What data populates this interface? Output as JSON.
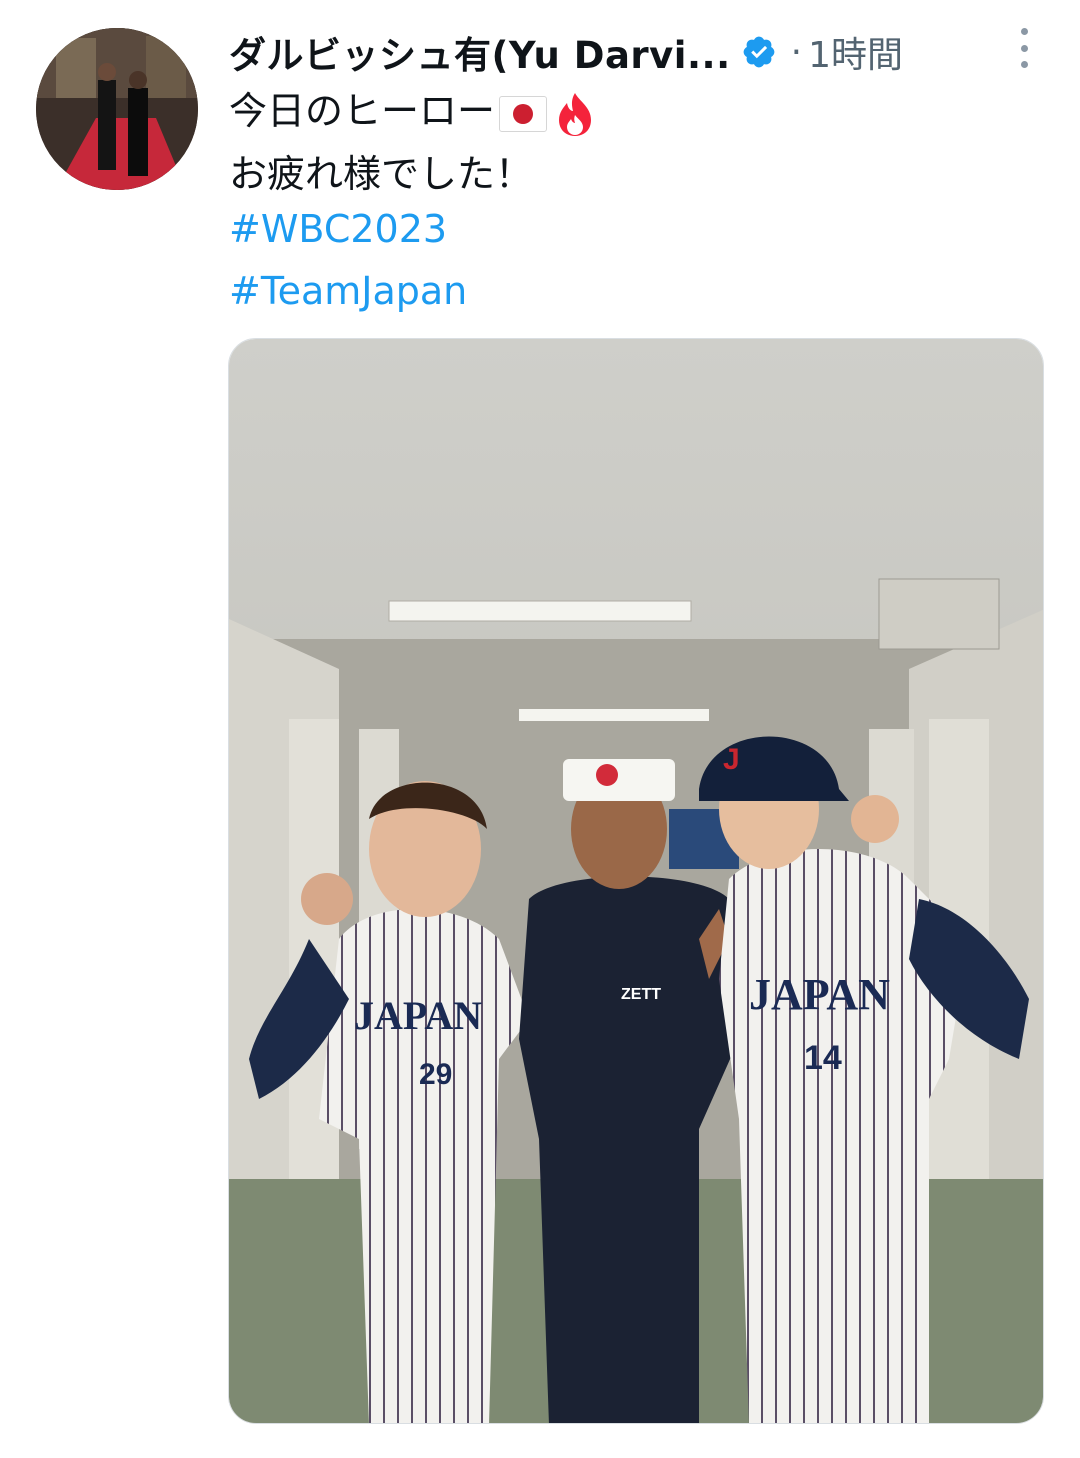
{
  "tweet": {
    "display_name": "ダルビッシュ有(Yu Darvi...",
    "separator": "·",
    "timestamp": "1時間",
    "text_line1": "今日のヒーロー",
    "text_line2": "お疲れ様でした！",
    "hashtags": [
      "#WBC2023",
      "#TeamJapan"
    ],
    "emojis": [
      "japan-flag",
      "fire"
    ]
  },
  "photo": {
    "jersey_wordmark": "JAPAN",
    "numbers": [
      "29",
      "14"
    ],
    "cap_letter": "J",
    "shirt_logo": "ZETT"
  },
  "colors": {
    "link": "#1d9bf0",
    "verified": "#1d9bf0",
    "muted": "#536471"
  },
  "icons": [
    "verified-badge-icon",
    "more-options-icon"
  ]
}
